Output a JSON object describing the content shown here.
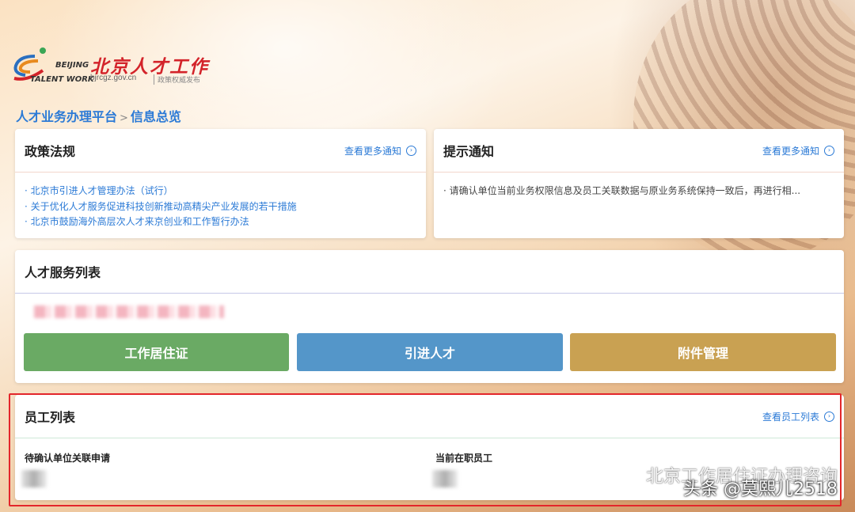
{
  "logo": {
    "en_line1": "BEIJING",
    "en_line2": "TALENT WORK",
    "cn_name": "北京人才工作",
    "url": "bjrcgz.gov.cn",
    "tagline": "政策权威发布"
  },
  "breadcrumb": {
    "root": "人才业务办理平台",
    "separator": ">",
    "current": "信息总览"
  },
  "policy_card": {
    "title": "政策法规",
    "more_label": "查看更多通知",
    "items": [
      "· 北京市引进人才管理办法（试行）",
      "· 关于优化人才服务促进科技创新推动高精尖产业发展的若干措施",
      "· 北京市鼓励海外高层次人才来京创业和工作暂行办法"
    ]
  },
  "notice_card": {
    "title": "提示通知",
    "more_label": "查看更多通知",
    "text": "· 请确认单位当前业务权限信息及员工关联数据与原业务系统保持一致后，再进行相..."
  },
  "service_card": {
    "title": "人才服务列表",
    "buttons": [
      {
        "label": "工作居住证",
        "color": "#6aaa64"
      },
      {
        "label": "引进人才",
        "color": "#5496c9"
      },
      {
        "label": "附件管理",
        "color": "#c9a152"
      }
    ]
  },
  "employee_card": {
    "title": "员工列表",
    "more_label": "查看员工列表",
    "pending_label": "待确认单位关联申请",
    "current_label": "当前在职员工"
  },
  "watermark": {
    "line1": "北京工作居住证办理咨询",
    "line2": "头条 @莫熙儿2518"
  },
  "colors": {
    "link": "#2b7ad6",
    "highlight_frame": "#e3262b"
  }
}
